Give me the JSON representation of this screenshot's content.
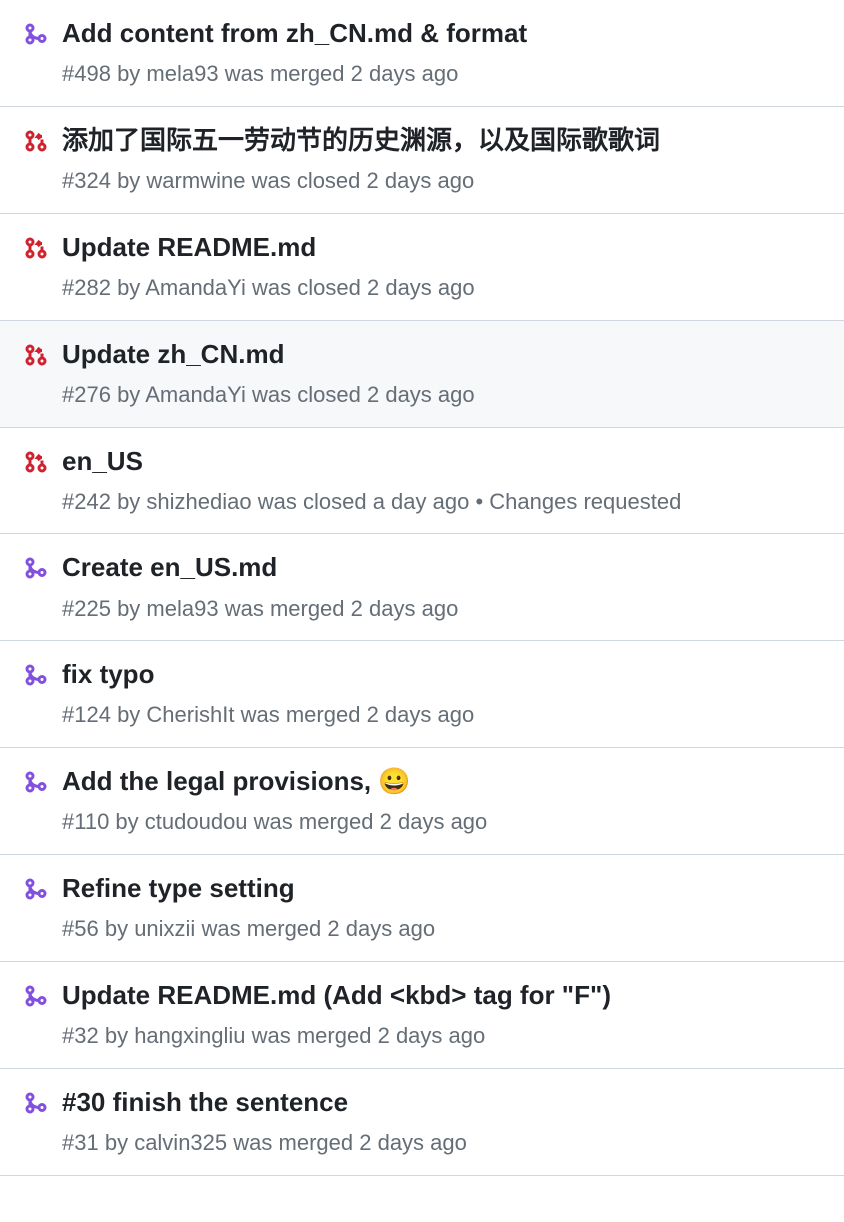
{
  "pull_requests": [
    {
      "status": "merged",
      "title": "Add content from zh_CN.md & format",
      "number": "#498",
      "author": "mela93",
      "action": "was merged",
      "time": "2 days ago",
      "extra": "",
      "highlighted": false
    },
    {
      "status": "closed",
      "title": "添加了国际五一劳动节的历史渊源，以及国际歌歌词",
      "number": "#324",
      "author": "warmwine",
      "action": "was closed",
      "time": "2 days ago",
      "extra": "",
      "highlighted": false
    },
    {
      "status": "closed",
      "title": "Update README.md",
      "number": "#282",
      "author": "AmandaYi",
      "action": "was closed",
      "time": "2 days ago",
      "extra": "",
      "highlighted": false
    },
    {
      "status": "closed",
      "title": "Update zh_CN.md",
      "number": "#276",
      "author": "AmandaYi",
      "action": "was closed",
      "time": "2 days ago",
      "extra": "",
      "highlighted": true
    },
    {
      "status": "closed",
      "title": "en_US",
      "number": "#242",
      "author": "shizhediao",
      "action": "was closed",
      "time": "a day ago",
      "extra": " • Changes requested",
      "highlighted": false
    },
    {
      "status": "merged",
      "title": "Create en_US.md",
      "number": "#225",
      "author": "mela93",
      "action": "was merged",
      "time": "2 days ago",
      "extra": "",
      "highlighted": false
    },
    {
      "status": "merged",
      "title": "fix typo",
      "number": "#124",
      "author": "CherishIt",
      "action": "was merged",
      "time": "2 days ago",
      "extra": "",
      "highlighted": false
    },
    {
      "status": "merged",
      "title": "Add the legal provisions, 😀",
      "number": "#110",
      "author": "ctudoudou",
      "action": "was merged",
      "time": "2 days ago",
      "extra": "",
      "highlighted": false
    },
    {
      "status": "merged",
      "title": "Refine type setting",
      "number": "#56",
      "author": "unixzii",
      "action": "was merged",
      "time": "2 days ago",
      "extra": "",
      "highlighted": false
    },
    {
      "status": "merged",
      "title": "Update README.md (Add <kbd> tag for \"F\")",
      "number": "#32",
      "author": "hangxingliu",
      "action": "was merged",
      "time": "2 days ago",
      "extra": "",
      "highlighted": false
    },
    {
      "status": "merged",
      "title": "#30 finish the sentence",
      "number": "#31",
      "author": "calvin325",
      "action": "was merged",
      "time": "2 days ago",
      "extra": "",
      "highlighted": false
    }
  ]
}
